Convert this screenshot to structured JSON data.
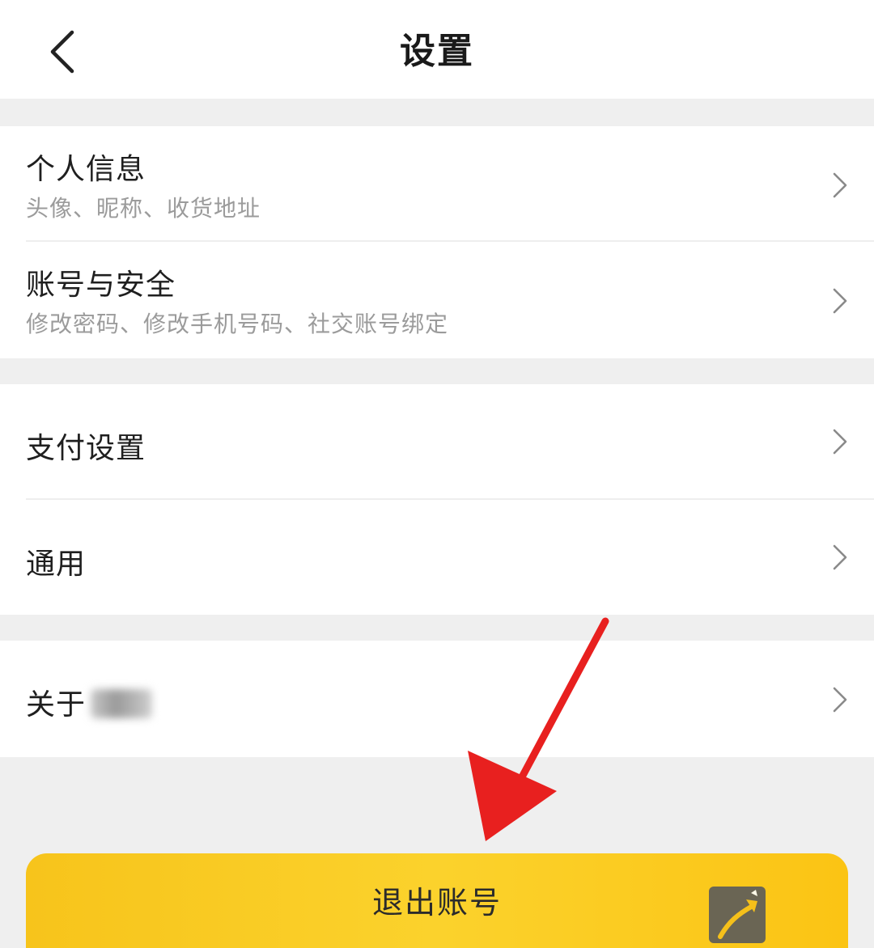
{
  "header": {
    "title": "设置",
    "back_icon": "chevron-left-icon"
  },
  "groups": [
    {
      "items": [
        {
          "title": "个人信息",
          "subtitle": "头像、昵称、收货地址",
          "icon": "chevron-right-icon"
        },
        {
          "title": "账号与安全",
          "subtitle": "修改密码、修改手机号码、社交账号绑定",
          "icon": "chevron-right-icon"
        }
      ]
    },
    {
      "items": [
        {
          "title": "支付设置",
          "icon": "chevron-right-icon"
        },
        {
          "title": "通用",
          "icon": "chevron-right-icon"
        }
      ]
    },
    {
      "items": [
        {
          "title": "关于",
          "icon": "chevron-right-icon"
        }
      ]
    }
  ],
  "logout": {
    "label": "退出账号"
  },
  "colors": {
    "accent": "#f9c81f",
    "background": "#efefef",
    "annotation_arrow": "#e8201f"
  }
}
